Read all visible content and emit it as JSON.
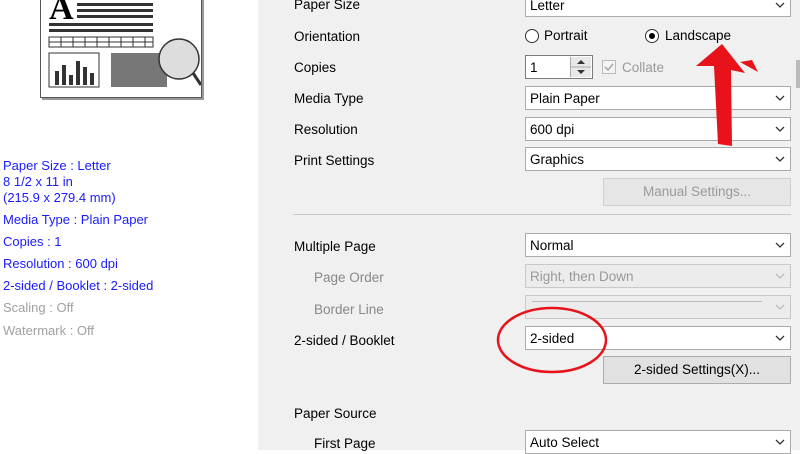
{
  "summary": {
    "paper_size": "Paper Size : Letter",
    "dims_in": "8 1/2 x 11 in",
    "dims_mm": "(215.9 x 279.4 mm)",
    "media_type": "Media Type : Plain Paper",
    "copies": "Copies : 1",
    "resolution": "Resolution : 600 dpi",
    "two_sided": "2-sided / Booklet : 2-sided",
    "scaling": "Scaling : Off",
    "watermark": "Watermark : Off"
  },
  "preview": {
    "glyph": "A"
  },
  "settings": {
    "paper_size": {
      "label": "Paper Size",
      "value": "Letter"
    },
    "orientation": {
      "label": "Orientation",
      "portrait": "Portrait",
      "landscape": "Landscape",
      "selected": "Landscape"
    },
    "copies": {
      "label": "Copies",
      "value": "1",
      "collate": "Collate"
    },
    "media_type": {
      "label": "Media Type",
      "value": "Plain Paper"
    },
    "resolution": {
      "label": "Resolution",
      "value": "600 dpi"
    },
    "print_settings": {
      "label": "Print Settings",
      "value": "Graphics",
      "manual_button": "Manual Settings..."
    },
    "multiple_page": {
      "label": "Multiple Page",
      "value": "Normal"
    },
    "page_order": {
      "label": "Page Order",
      "value": "Right, then Down"
    },
    "border_line": {
      "label": "Border Line",
      "value": ""
    },
    "two_sided": {
      "label": "2-sided / Booklet",
      "value": "2-sided",
      "settings_button": "2-sided Settings(X)..."
    },
    "paper_source": {
      "label": "Paper Source"
    },
    "first_page": {
      "label": "First Page",
      "value": "Auto Select"
    }
  },
  "annotation_colors": {
    "arrow": "#e8121b",
    "circle": "#e8121b"
  }
}
